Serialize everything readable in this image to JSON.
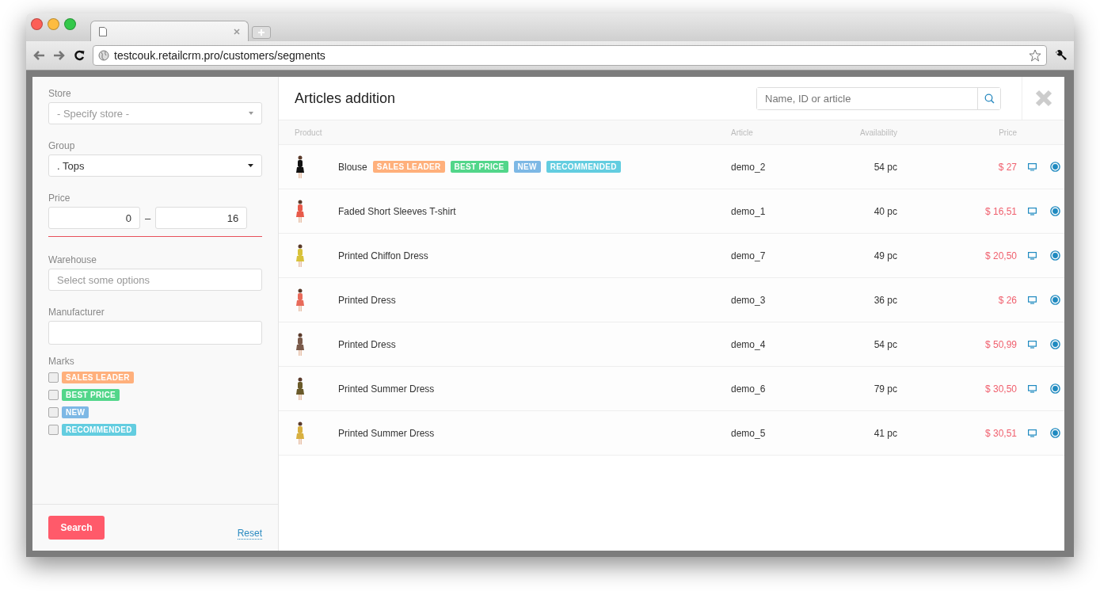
{
  "browser": {
    "url": "testcouk.retailcrm.pro/customers/segments"
  },
  "filters": {
    "store": {
      "label": "Store",
      "placeholder": "- Specify store -"
    },
    "group": {
      "label": "Group",
      "value": ". Tops"
    },
    "price": {
      "label": "Price",
      "from": "0",
      "separator": "–",
      "to": "16"
    },
    "warehouse": {
      "label": "Warehouse",
      "placeholder": "Select some options"
    },
    "manufacturer": {
      "label": "Manufacturer"
    },
    "marks": {
      "label": "Marks",
      "items": [
        {
          "label": "SALES LEADER",
          "color": "#ffb07c",
          "checked": false
        },
        {
          "label": "BEST PRICE",
          "color": "#52d68a",
          "checked": false
        },
        {
          "label": "NEW",
          "color": "#7db8e5",
          "checked": false
        },
        {
          "label": "RECOMMENDED",
          "color": "#63cde0",
          "checked": false
        }
      ]
    },
    "search_button": "Search",
    "reset_link": "Reset"
  },
  "dialog": {
    "title": "Articles addition",
    "search": {
      "placeholder": "Name, ID or article"
    },
    "columns": [
      "Product",
      "Article",
      "Availability",
      "Price"
    ],
    "rows": [
      {
        "name": "Blouse",
        "tags": [
          {
            "label": "SALES LEADER",
            "color": "#ffb07c"
          },
          {
            "label": "BEST PRICE",
            "color": "#52d68a"
          },
          {
            "label": "NEW",
            "color": "#7db8e5"
          },
          {
            "label": "RECOMMENDED",
            "color": "#63cde0"
          }
        ],
        "article": "demo_2",
        "availability": "54 pc",
        "price": "$ 27"
      },
      {
        "name": "Faded Short Sleeves T-shirt",
        "article": "demo_1",
        "availability": "40 pc",
        "price": "$ 16,51"
      },
      {
        "name": "Printed Chiffon Dress",
        "article": "demo_7",
        "availability": "49 pc",
        "price": "$ 20,50"
      },
      {
        "name": "Printed Dress",
        "article": "demo_3",
        "availability": "36 pc",
        "price": "$ 26"
      },
      {
        "name": "Printed Dress",
        "article": "demo_4",
        "availability": "54 pc",
        "price": "$ 50,99"
      },
      {
        "name": "Printed Summer Dress",
        "article": "demo_6",
        "availability": "79 pc",
        "price": "$ 30,50"
      },
      {
        "name": "Printed Summer Dress",
        "article": "demo_5",
        "availability": "41 pc",
        "price": "$ 30,51"
      }
    ]
  }
}
